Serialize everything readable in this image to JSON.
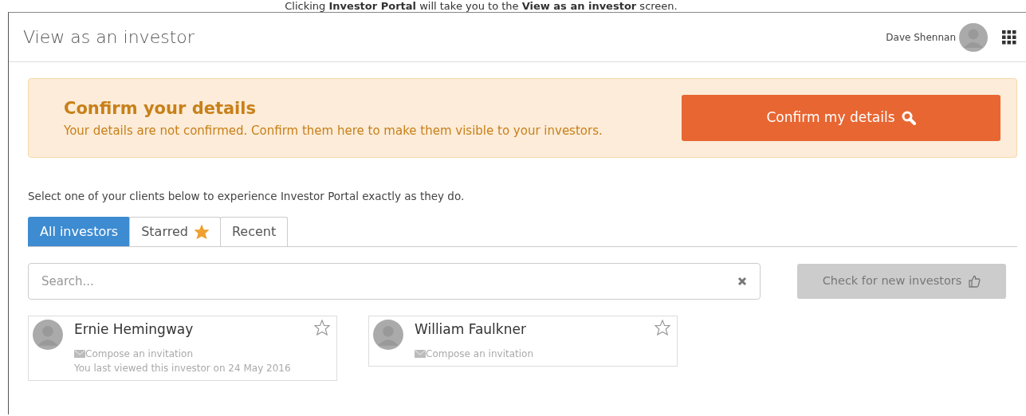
{
  "caption": "Clicking **Investor Portal** will take you to the **View as an investor** screen.",
  "window": {
    "title": "View as an investor"
  },
  "user": {
    "name": "Dave Shennan"
  },
  "alert": {
    "title": "Confirm your details",
    "message": "Your details are not confirmed. Confirm them here to make them visible to your investors.",
    "button": "Confirm my details"
  },
  "intro": "Select one of your clients below to experience Investor Portal exactly as they do.",
  "tabs": [
    {
      "label": "All investors",
      "selected": true,
      "kind": "plain"
    },
    {
      "label": "Starred",
      "selected": false,
      "kind": "star"
    },
    {
      "label": "Recent",
      "selected": false,
      "kind": "plain"
    }
  ],
  "search": {
    "placeholder": "Search..."
  },
  "check_button": {
    "label": "Check for new investors",
    "disabled": true
  },
  "investors": [
    {
      "name": "Ernie Hemingway",
      "starred": false,
      "invite": "Compose an invitation",
      "last_viewed": "You last viewed this investor on 24 May 2016"
    },
    {
      "name": "William Faulkner",
      "starred": false,
      "invite": "Compose an invitation"
    }
  ]
}
